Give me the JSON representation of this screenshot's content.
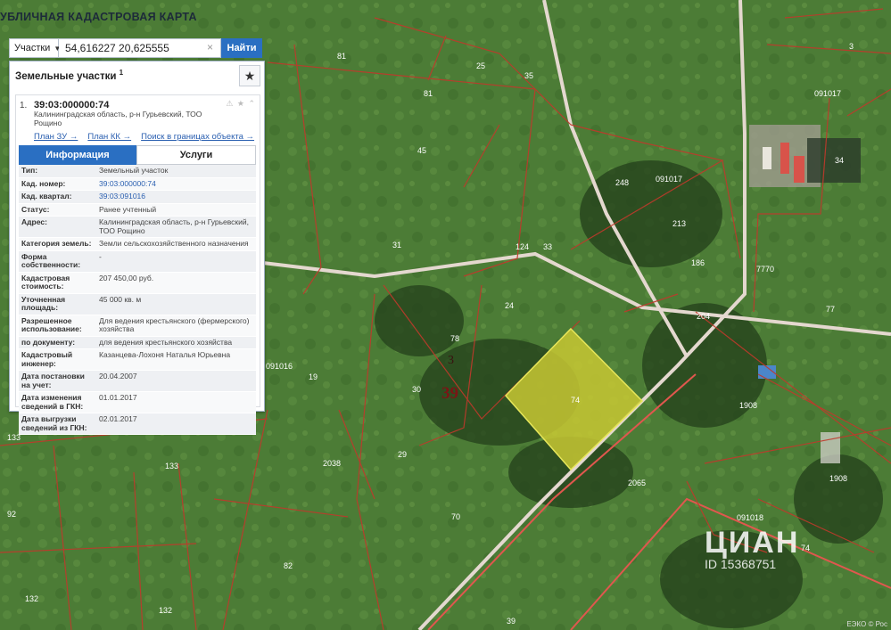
{
  "app": {
    "title": "УБЛИЧНАЯ КАДАСТРОВАЯ КАРТА"
  },
  "search": {
    "type_label": "Участки",
    "query": "54,616227 20,625555",
    "button_label": "Найти"
  },
  "panel": {
    "title": "Земельные участки",
    "count": "1",
    "result": {
      "number": "1.",
      "cad_id": "39:03:000000:74",
      "address": "Калининградская область, р-н Гурьевский, ТОО Рощино",
      "links": [
        "План ЗУ →",
        "План КК →",
        "Поиск в границах объекта →"
      ],
      "tabs": [
        "Информация",
        "Услуги"
      ],
      "properties": [
        {
          "key": "Тип:",
          "value": "Земельный участок"
        },
        {
          "key": "Кад. номер:",
          "value": "39:03:000000:74"
        },
        {
          "key": "Кад. квартал:",
          "value": "39:03:091016"
        },
        {
          "key": "Статус:",
          "value": "Ранее учтенный"
        },
        {
          "key": "Адрес:",
          "value": "Калининградская область, р-н Гурьевский, ТОО Рощино"
        },
        {
          "key": "Категория земель:",
          "value": "Земли сельскохозяйственного назначения"
        },
        {
          "key": "Форма собственности:",
          "value": "-"
        },
        {
          "key": "Кадастровая стоимость:",
          "value": "207 450,00 руб."
        },
        {
          "key": "Уточненная площадь:",
          "value": "45 000 кв. м"
        },
        {
          "key": "Разрешенное использование:",
          "value": "Для ведения крестьянского (фермерского) хозяйства"
        },
        {
          "key": "по документу:",
          "value": "для ведения крестьянского хозяйства"
        },
        {
          "key": "Кадастровый инженер:",
          "value": "Казанцева-Лохоня Наталья Юрьевна"
        },
        {
          "key": "Дата постановки на учет:",
          "value": "20.04.2007"
        },
        {
          "key": "Дата изменения сведений в ГКН:",
          "value": "01.01.2017"
        },
        {
          "key": "Дата выгрузки сведений из ГКН:",
          "value": "02.01.2017"
        }
      ]
    }
  },
  "map": {
    "highlight_color": "#c8c832",
    "boundary_color": "#c0392b",
    "plot_labels": [
      "74",
      "3",
      "39",
      "78",
      "30",
      "24",
      "124",
      "33",
      "31",
      "45",
      "81",
      "25",
      "35",
      "248",
      "213",
      "186",
      "204",
      "77",
      "7770",
      "1908",
      "2065",
      "29",
      "70",
      "2038",
      "133",
      "92",
      "82",
      "132",
      "19",
      "39",
      "74",
      "27",
      "61",
      "91"
    ],
    "quarter_labels": [
      "091017",
      "091016",
      "091018",
      "091017"
    ]
  },
  "watermark": {
    "brand": "ЦИАН",
    "id": "ID 15368751"
  },
  "copyright": "ЕЭКО © Рос"
}
